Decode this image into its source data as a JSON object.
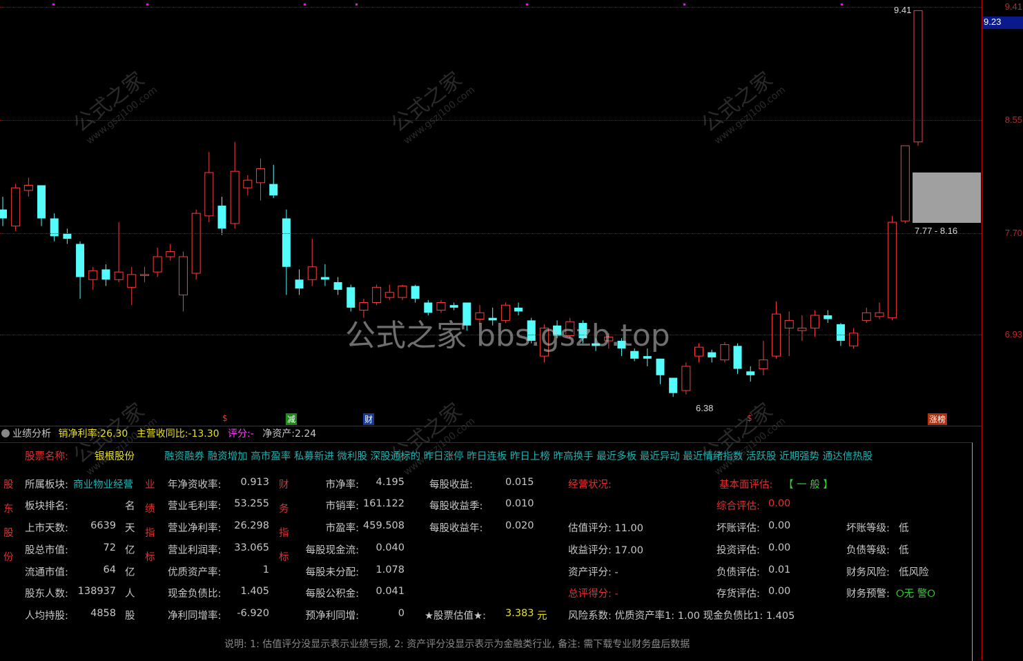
{
  "axis": {
    "labels": [
      "9.41",
      "8.55",
      "7.70",
      "6.93"
    ],
    "current_price": "9.23"
  },
  "annotations": {
    "high": "9.41",
    "low": "6.38",
    "zone": "7.77 - 8.16"
  },
  "signals": [
    "$",
    "减",
    "财",
    "$",
    "涨榜"
  ],
  "watermark": {
    "brand": "公式之家",
    "url": "www.gszj100.com",
    "center": "公式之家 bbs.gszb.top"
  },
  "chart_data": {
    "type": "candlestick",
    "ylim": [
      6.3,
      9.45
    ],
    "candles": [
      [
        7.85,
        7.78,
        7.95,
        7.72
      ],
      [
        7.72,
        8.02,
        8.05,
        7.68
      ],
      [
        8.0,
        8.04,
        8.1,
        7.95
      ],
      [
        8.04,
        7.78,
        8.04,
        7.72
      ],
      [
        7.78,
        7.64,
        7.82,
        7.6
      ],
      [
        7.66,
        7.62,
        7.7,
        7.58
      ],
      [
        7.58,
        7.32,
        7.6,
        7.15
      ],
      [
        7.3,
        7.37,
        7.4,
        7.22
      ],
      [
        7.38,
        7.3,
        7.42,
        7.25
      ],
      [
        7.3,
        7.36,
        7.75,
        7.28
      ],
      [
        7.24,
        7.34,
        7.4,
        7.1
      ],
      [
        7.34,
        7.34,
        7.4,
        7.28
      ],
      [
        7.36,
        7.48,
        7.55,
        7.32
      ],
      [
        7.48,
        7.52,
        7.58,
        7.45
      ],
      [
        7.18,
        7.48,
        7.52,
        7.05
      ],
      [
        7.35,
        7.82,
        7.85,
        7.3
      ],
      [
        7.8,
        8.14,
        8.3,
        7.75
      ],
      [
        7.88,
        7.7,
        7.95,
        7.65
      ],
      [
        7.74,
        8.15,
        8.38,
        7.7
      ],
      [
        8.02,
        8.08,
        8.12,
        7.96
      ],
      [
        8.06,
        8.17,
        8.25,
        7.92
      ],
      [
        8.05,
        7.96,
        8.2,
        7.94
      ],
      [
        7.78,
        7.4,
        7.85,
        7.18
      ],
      [
        7.3,
        7.23,
        7.38,
        7.18
      ],
      [
        7.3,
        7.4,
        7.62,
        7.25
      ],
      [
        7.32,
        7.3,
        7.42,
        7.25
      ],
      [
        7.28,
        7.22,
        7.32,
        7.18
      ],
      [
        7.24,
        7.08,
        7.26,
        7.05
      ],
      [
        7.06,
        7.12,
        7.15,
        7.0
      ],
      [
        7.12,
        7.24,
        7.26,
        7.1
      ],
      [
        7.16,
        7.2,
        7.26,
        7.14
      ],
      [
        7.16,
        7.25,
        7.26,
        7.14
      ],
      [
        7.25,
        7.15,
        7.26,
        7.12
      ],
      [
        7.12,
        7.04,
        7.14,
        7.02
      ],
      [
        7.06,
        7.12,
        7.14,
        7.04
      ],
      [
        7.1,
        7.08,
        7.12,
        7.06
      ],
      [
        7.12,
        6.94,
        7.12,
        6.9
      ],
      [
        6.99,
        7.04,
        7.1,
        6.95
      ],
      [
        7.0,
        6.98,
        7.08,
        6.94
      ],
      [
        6.98,
        7.1,
        7.12,
        6.96
      ],
      [
        7.08,
        7.05,
        7.12,
        7.02
      ],
      [
        6.98,
        6.82,
        7.0,
        6.8
      ],
      [
        6.7,
        6.92,
        6.95,
        6.65
      ],
      [
        6.94,
        6.86,
        6.98,
        6.84
      ],
      [
        6.86,
        6.97,
        7.0,
        6.84
      ],
      [
        6.96,
        6.84,
        6.98,
        6.8
      ],
      [
        6.8,
        6.78,
        6.84,
        6.74
      ],
      [
        6.82,
        6.85,
        6.88,
        6.76
      ],
      [
        6.82,
        6.76,
        6.84,
        6.7
      ],
      [
        6.74,
        6.68,
        6.76,
        6.66
      ],
      [
        6.7,
        6.68,
        6.76,
        6.62
      ],
      [
        6.68,
        6.55,
        6.68,
        6.48
      ],
      [
        6.53,
        6.41,
        6.53,
        6.38
      ],
      [
        6.43,
        6.62,
        6.65,
        6.4
      ],
      [
        6.7,
        6.77,
        6.8,
        6.65
      ],
      [
        6.73,
        6.69,
        6.75,
        6.65
      ],
      [
        6.67,
        6.79,
        6.81,
        6.65
      ],
      [
        6.78,
        6.6,
        6.8,
        6.56
      ],
      [
        6.58,
        6.55,
        6.62,
        6.5
      ],
      [
        6.6,
        6.67,
        6.82,
        6.55
      ],
      [
        6.7,
        7.03,
        7.13,
        6.68
      ],
      [
        6.92,
        6.98,
        7.05,
        6.7
      ],
      [
        6.9,
        6.92,
        7.02,
        6.82
      ],
      [
        6.92,
        7.02,
        7.06,
        6.85
      ],
      [
        7.02,
        6.99,
        7.06,
        6.96
      ],
      [
        6.95,
        6.82,
        6.96,
        6.78
      ],
      [
        6.78,
        6.88,
        6.92,
        6.76
      ],
      [
        6.98,
        7.04,
        7.08,
        6.96
      ],
      [
        7.01,
        7.04,
        7.12,
        6.99
      ],
      [
        7.0,
        7.75,
        7.8,
        6.98
      ],
      [
        7.76,
        8.35,
        8.35,
        7.74
      ],
      [
        8.38,
        9.41,
        9.41,
        8.35
      ]
    ]
  },
  "info_bar": {
    "title": "业绩分析",
    "net_margin_label": "销净利率:",
    "net_margin_value": "26.30",
    "revenue_yoy_label": "主营收同比:",
    "revenue_yoy_value": "-13.30",
    "score_label": "评分:",
    "score_value": "-",
    "net_assets_label": "净资产:",
    "net_assets_value": "2.24"
  },
  "panel": {
    "stock_name_label": "股票名称:",
    "stock_name_value": "银根股份",
    "tags": "融资融券 融资增加 高市盈率 私募新进 微利股 深股通标的 昨日涨停 昨日连板 昨日上榜 昨高换手 最近多板 最近异动 最近情绪指数 活跃股 近期强势 通达信热股",
    "side_shareholder": [
      "股",
      "东",
      "股",
      "份"
    ],
    "side_perf": [
      "业",
      "绩",
      "指",
      "标"
    ],
    "side_fin": [
      "财",
      "务",
      "指",
      "标"
    ],
    "sector_label": "所属板块:",
    "sector_value": "商业物业经营",
    "rank_label": "板块排名:",
    "rank_unit": "名",
    "days_label": "上市天数:",
    "days_value": "6639",
    "days_unit": "天",
    "total_cap_label": "股总市值:",
    "total_cap_value": "72",
    "total_cap_unit": "亿",
    "float_cap_label": "流通市值:",
    "float_cap_value": "64",
    "float_cap_unit": "亿",
    "holders_label": "股东人数:",
    "holders_value": "138937",
    "holders_unit": "人",
    "avg_hold_label": "人均持股:",
    "avg_hold_value": "4858",
    "avg_hold_unit": "股",
    "perf": [
      {
        "label": "年净资收率:",
        "value": "0.913"
      },
      {
        "label": "营业毛利率:",
        "value": "53.255"
      },
      {
        "label": "营业净利率:",
        "value": "26.298"
      },
      {
        "label": "营业利润率:",
        "value": "33.065"
      },
      {
        "label": "优质资产率:",
        "value": "1"
      },
      {
        "label": "现金负债比:",
        "value": "1.405"
      },
      {
        "label": "净利同增率:",
        "value": "-6.920"
      }
    ],
    "fin": [
      {
        "label": "市净率:",
        "value": "4.195"
      },
      {
        "label": "市销率:",
        "value": "161.122"
      },
      {
        "label": "市盈率:",
        "value": "459.508"
      },
      {
        "label": "每股现金流:",
        "value": "0.040"
      },
      {
        "label": "每股未分配:",
        "value": "1.078"
      },
      {
        "label": "每股公积金:",
        "value": "0.041"
      },
      {
        "label": "预净利同增:",
        "value": "0"
      }
    ],
    "eps": [
      {
        "label": "每股收益:",
        "value": "0.015"
      },
      {
        "label": "每股收益季:",
        "value": "0.010"
      },
      {
        "label": "每股收益年:",
        "value": "0.020"
      }
    ],
    "valuation_label": "★股票估值★:",
    "valuation_value": "3.383",
    "valuation_unit": "元",
    "ops_title": "经营状况:",
    "est_score": "估值评分: 11.00",
    "income_score": "收益评分: 17.00",
    "asset_score": "资产评分: -",
    "total_score": "总评得分: -",
    "risk": "风险系数: 优质资产率1: 1.00 现金负债比1: 1.405",
    "fund_label": "基本面评估:",
    "fund_value": "【 一 般 】",
    "overall_label": "综合评估:",
    "overall_value": "0.00",
    "evals": [
      {
        "label": "坏账评估:",
        "value": "0.00"
      },
      {
        "label": "投资评估:",
        "value": "0.00"
      },
      {
        "label": "负债评估:",
        "value": "0.01"
      },
      {
        "label": "存货评估:",
        "value": "0.00"
      }
    ],
    "levels": [
      {
        "label": "坏账等级:",
        "value": "低"
      },
      {
        "label": "负债等级:",
        "value": "低"
      },
      {
        "label": "财务风险:",
        "value": "低风险"
      }
    ],
    "warning_label": "财务预警:",
    "warning_value": "⭘无 警⭘",
    "note": "说明: 1: 估值评分没显示表示业绩亏损, 2: 资产评分没显示表示为金融类行业, 备注: 需下载专业财务盘后数据"
  }
}
